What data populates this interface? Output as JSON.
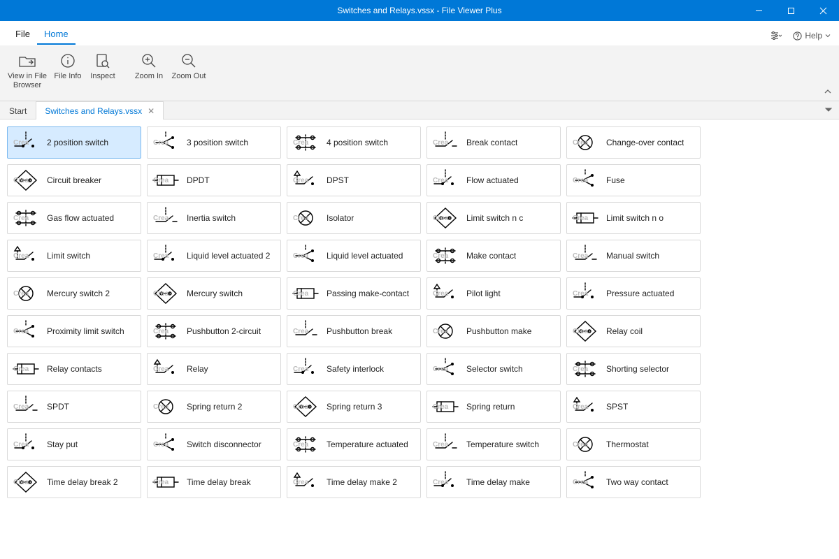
{
  "window": {
    "title": "Switches and Relays.vssx - File Viewer Plus",
    "help_label": "Help"
  },
  "menu": {
    "file": "File",
    "home": "Home"
  },
  "ribbon": {
    "view_in_file_browser": "View in File\nBrowser",
    "file_info": "File Info",
    "inspect": "Inspect",
    "zoom_in": "Zoom In",
    "zoom_out": "Zoom Out"
  },
  "tabs": {
    "start": "Start",
    "document": "Switches and Relays.vssx"
  },
  "watermark": "Crea",
  "stencils": [
    "2 position switch",
    "3 position switch",
    "4 position switch",
    "Break contact",
    "Change-over contact",
    "Circuit breaker",
    "DPDT",
    "DPST",
    "Flow actuated",
    "Fuse",
    "Gas flow actuated",
    "Inertia switch",
    "Isolator",
    "Limit switch n c",
    "Limit switch n o",
    "Limit switch",
    "Liquid level actuated 2",
    "Liquid level actuated",
    "Make contact",
    "Manual switch",
    "Mercury switch 2",
    "Mercury switch",
    "Passing make-contact",
    "Pilot light",
    "Pressure actuated",
    "Proximity limit switch",
    "Pushbutton 2-circuit",
    "Pushbutton break",
    "Pushbutton make",
    "Relay coil",
    "Relay contacts",
    "Relay",
    "Safety interlock",
    "Selector switch",
    "Shorting selector",
    "SPDT",
    "Spring return 2",
    "Spring return 3",
    "Spring return",
    "SPST",
    "Stay put",
    "Switch disconnector",
    "Temperature actuated",
    "Temperature switch",
    "Thermostat",
    "Time delay break 2",
    "Time delay break",
    "Time delay make 2",
    "Time delay make",
    "Two way contact"
  ],
  "selected_index": 0
}
